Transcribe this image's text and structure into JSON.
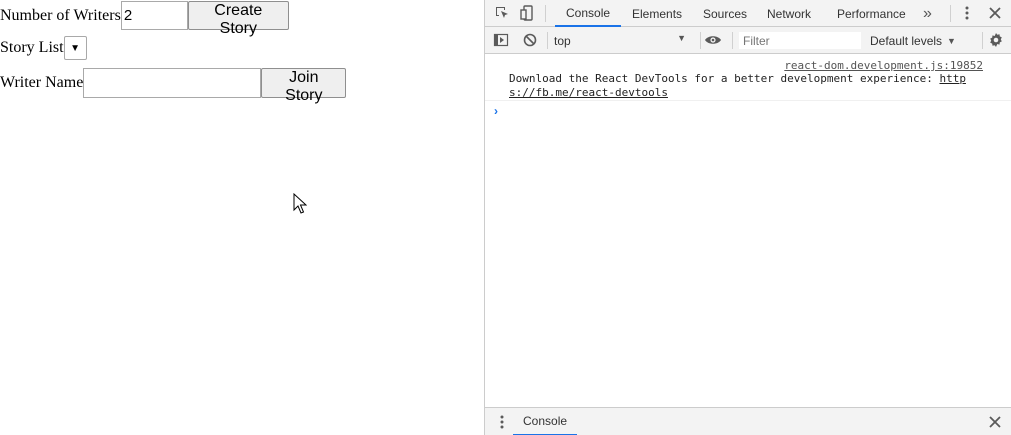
{
  "app": {
    "writers_label": "Number of Writers",
    "writers_value": "2",
    "create_button": "Create Story",
    "story_list_label": "Story List",
    "story_select_arrow": "▼",
    "writer_name_label": "Writer Name",
    "writer_name_value": "",
    "join_button": "Join Story"
  },
  "devtools": {
    "tabs": [
      "Console",
      "Elements",
      "Sources",
      "Network",
      "Performance"
    ],
    "active_tab": "Console",
    "more_tabs_glyph": "»",
    "context": "top",
    "filter_placeholder": "Filter",
    "levels": "Default levels",
    "message": {
      "source": "react-dom.development.js:19852",
      "line1": "Download the React DevTools for a better development experience: ",
      "link_part1": "http",
      "link_part2": "s://fb.me/react-devtools"
    },
    "prompt_glyph": "›",
    "drawer_tab": "Console",
    "accent_color": "#1a73e8"
  }
}
